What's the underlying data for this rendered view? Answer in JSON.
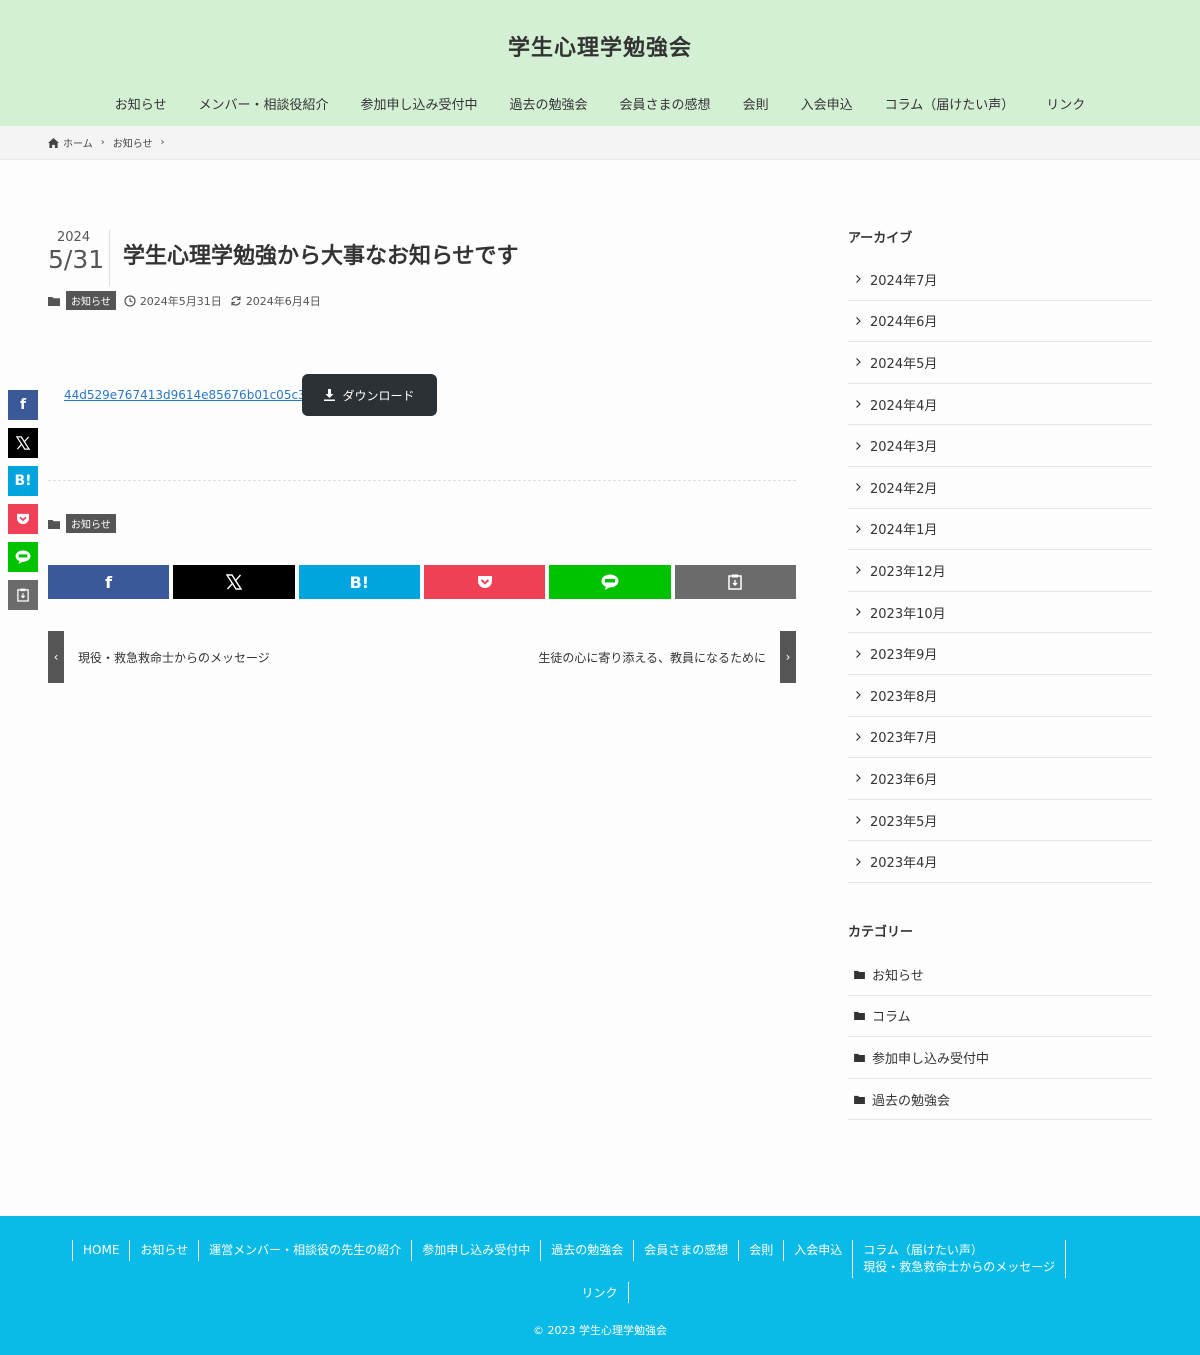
{
  "header": {
    "site_title": "学生心理学勉強会",
    "nav": [
      "お知らせ",
      "メンバー・相談役紹介",
      "参加申し込み受付中",
      "過去の勉強会",
      "会員さまの感想",
      "会則",
      "入会申込",
      "コラム（届けたい声）",
      "リンク"
    ]
  },
  "breadcrumb": {
    "home": "ホーム",
    "category": "お知らせ"
  },
  "post": {
    "year": "2024",
    "month_day": "5/31",
    "title": "学生心理学勉強から大事なお知らせです",
    "category": "お知らせ",
    "published": "2024年5月31日",
    "updated": "2024年6月4日",
    "file_name": "44d529e767413d9614e85676b01c05c3",
    "download_label": "ダウンロード",
    "footer_category": "お知らせ"
  },
  "share": {
    "facebook": "f",
    "x": "X",
    "hatena": "B!",
    "icons": [
      "facebook-icon",
      "x-icon",
      "hatena-icon",
      "pocket-icon",
      "line-icon",
      "copy-icon"
    ]
  },
  "prev_next": {
    "prev": "現役・救急救命士からのメッセージ",
    "next": "生徒の心に寄り添える、教員になるために"
  },
  "sidebar": {
    "archive_title": "アーカイブ",
    "archives": [
      "2024年7月",
      "2024年6月",
      "2024年5月",
      "2024年4月",
      "2024年3月",
      "2024年2月",
      "2024年1月",
      "2023年12月",
      "2023年10月",
      "2023年9月",
      "2023年8月",
      "2023年7月",
      "2023年6月",
      "2023年5月",
      "2023年4月"
    ],
    "category_title": "カテゴリー",
    "categories": [
      "お知らせ",
      "コラム",
      "参加申し込み受付中",
      "過去の勉強会"
    ]
  },
  "footer": {
    "nav": [
      "HOME",
      "お知らせ",
      "運営メンバー・相談役の先生の紹介",
      "参加申し込み受付中",
      "過去の勉強会",
      "会員さまの感想",
      "会則",
      "入会申込",
      "コラム（届けたい声）"
    ],
    "nav_sub": "現役・救急救命士からのメッセージ",
    "nav_row2": "リンク",
    "copyright": "© 2023 学生心理学勉強会"
  },
  "colors": {
    "header_bg": "#d4f0d4",
    "footer_bg": "#09bbe6",
    "facebook": "#3b5998",
    "x": "#000000",
    "hatena": "#00a4de",
    "pocket": "#ef4056",
    "line": "#00c300",
    "copy": "#6b6b6b"
  }
}
